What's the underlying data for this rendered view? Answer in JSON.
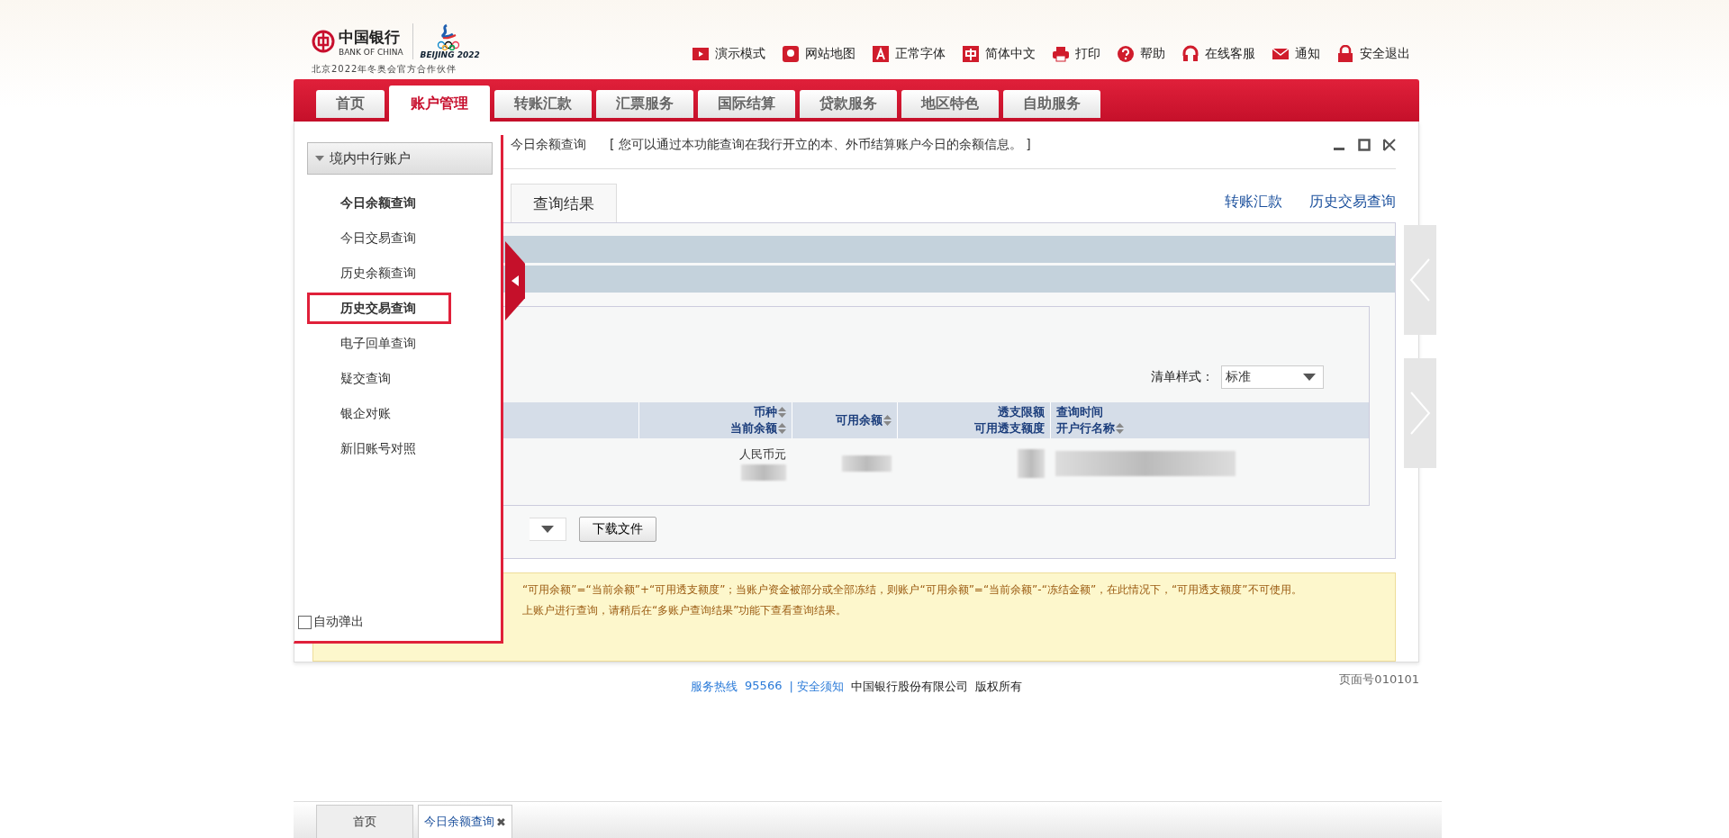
{
  "header": {
    "logo": {
      "bank_cn": "中国银行",
      "bank_en": "BANK OF CHINA",
      "olympic": "BEIJING 2022",
      "partner": "北京2022年冬奥会官方合作伙伴"
    },
    "tools": [
      {
        "kind": "video",
        "label": "演示模式"
      },
      {
        "kind": "pin",
        "label": "网站地图"
      },
      {
        "kind": "font",
        "label": "正常字体"
      },
      {
        "kind": "lang",
        "label": "简体中文"
      },
      {
        "kind": "print",
        "label": "打印"
      },
      {
        "kind": "help",
        "label": "帮助"
      },
      {
        "kind": "headset",
        "label": "在线客服"
      },
      {
        "kind": "mail",
        "label": "通知"
      },
      {
        "kind": "lock",
        "label": "安全退出"
      }
    ]
  },
  "nav": [
    {
      "label": "首页",
      "selected": false
    },
    {
      "label": "账户管理",
      "selected": true
    },
    {
      "label": "转账汇款",
      "selected": false
    },
    {
      "label": "汇票服务",
      "selected": false
    },
    {
      "label": "国际结算",
      "selected": false
    },
    {
      "label": "贷款服务",
      "selected": false
    },
    {
      "label": "地区特色",
      "selected": false
    },
    {
      "label": "自助服务",
      "selected": false
    }
  ],
  "panel": {
    "breadcrumb": "今日余额查询",
    "description": "[ 您可以通过本功能查询在我行开立的本、外币结算账户今日的余额信息。 ]",
    "tabs": [
      {
        "label": "查询结果",
        "selected": true
      }
    ],
    "links": [
      "转账汇款",
      "历史交易查询"
    ],
    "list_style": {
      "label": "清单样式：",
      "value": "标准"
    },
    "columns": [
      {
        "lines": [
          {
            "text": "币种",
            "sortable": true
          },
          {
            "text": "当前余额",
            "sortable": true
          }
        ]
      },
      {
        "lines": [
          {
            "text": "可用余额",
            "sortable": true
          }
        ]
      },
      {
        "lines": [
          {
            "text": "透支限额",
            "sortable": false
          },
          {
            "text": "可用透支额度",
            "sortable": false
          }
        ]
      },
      {
        "lines": [
          {
            "text": "查询时间",
            "sortable": false
          },
          {
            "text": "开户行名称",
            "sortable": true
          }
        ]
      }
    ],
    "row": {
      "currency": "人民币元"
    },
    "download_button": "下载文件",
    "notes": [
      "“可用余额”=“当前余额”+“可用透支额度”；当账户资金被部分或全部冻结，则账户“可用余额”=“当前余额”-“冻结金额”，在此情况下，“可用透支额度”不可使用。",
      "上账户进行查询，请稍后在“多账户查询结果”功能下查看查询结果。"
    ]
  },
  "side_menu": {
    "heading": "境内中行账户",
    "expanded": true,
    "items": [
      {
        "label": "今日余额查询",
        "bold": true,
        "highlighted": false
      },
      {
        "label": "今日交易查询",
        "bold": false,
        "highlighted": false
      },
      {
        "label": "历史余额查询",
        "bold": false,
        "highlighted": false
      },
      {
        "label": "历史交易查询",
        "bold": true,
        "highlighted": true
      },
      {
        "label": "电子回单查询",
        "bold": false,
        "highlighted": false
      },
      {
        "label": "疑交查询",
        "bold": false,
        "highlighted": false
      },
      {
        "label": "银企对账",
        "bold": false,
        "highlighted": false
      },
      {
        "label": "新旧账号对照",
        "bold": false,
        "highlighted": false
      }
    ],
    "auto_popup": {
      "label": "自动弹出",
      "checked": false
    }
  },
  "footer": {
    "hotline_label": "服务热线",
    "hotline": "95566",
    "notice": "| 安全须知",
    "company": "中国银行股份有限公司",
    "rights": "版权所有",
    "page_number": "页面号010101"
  },
  "bottom_tabs": [
    {
      "label": "首页",
      "selected": false
    },
    {
      "label": "今日余额查询",
      "selected": true,
      "close": "✖"
    }
  ]
}
